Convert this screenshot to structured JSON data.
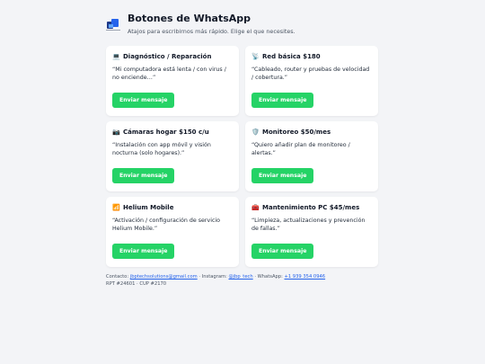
{
  "header": {
    "logo_icon": "company-logo",
    "title": "Botones de WhatsApp",
    "subtitle": "Atajos para escribirnos más rápido. Elige el que necesites."
  },
  "cards": [
    {
      "icon": "💻",
      "icon_name": "laptop-icon",
      "title": "Diagnóstico / Reparación",
      "desc": "“Mi computadora está lenta / con virus / no enciende…”",
      "button": "Enviar mensaje"
    },
    {
      "icon": "📡",
      "icon_name": "antenna-icon",
      "title": "Red básica $180",
      "desc": "“Cableado, router y pruebas de velocidad / cobertura.”",
      "button": "Enviar mensaje"
    },
    {
      "icon": "📷",
      "icon_name": "camera-icon",
      "title": "Cámaras hogar $150 c/u",
      "desc": "“Instalación con app móvil y visión nocturna (solo hogares).”",
      "button": "Enviar mensaje"
    },
    {
      "icon": "🛡️",
      "icon_name": "shield-icon",
      "title": "Monitoreo $50/mes",
      "desc": "“Quiero añadir plan de monitoreo / alertas.”",
      "button": "Enviar mensaje"
    },
    {
      "icon": "📶",
      "icon_name": "signal-bars-icon",
      "title": "Helium Mobile",
      "desc": "“Activación / configuración de servicio Helium Mobile.”",
      "button": "Enviar mensaje"
    },
    {
      "icon": "🧰",
      "icon_name": "toolbox-icon",
      "title": "Mantenimiento PC $45/mes",
      "desc": "“Limpieza, actualizaciones y prevención de fallas.”",
      "button": "Enviar mensaje"
    }
  ],
  "footer": {
    "contact_label": "Contacto:",
    "email": "jbptechsolutions@gmail.com",
    "instagram_label": "· Instagram:",
    "instagram": "@jbp_tech",
    "whatsapp_label": "· WhatsApp:",
    "whatsapp": "+1 939 354 0946",
    "license": "RPT #24601 · CUP #2170"
  },
  "colors": {
    "whatsapp_green": "#25d366",
    "background": "#f3f4f7",
    "link": "#2563eb"
  }
}
